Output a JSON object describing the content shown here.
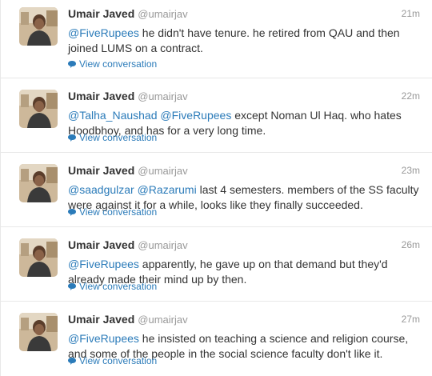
{
  "tweets": [
    {
      "name": "Umair Javed",
      "handle": "@umairjav",
      "time": "21m",
      "mentions": [
        "@FiveRupees"
      ],
      "body": " he didn't have tenure. he retired from QAU and then joined LUMS on a contract.",
      "conversation_label": "View conversation"
    },
    {
      "name": "Umair Javed",
      "handle": "@umairjav",
      "time": "22m",
      "mentions": [
        "@Talha_Naushad",
        "@FiveRupees"
      ],
      "body": " except Noman Ul Haq. who hates Hoodbhoy, and has for a very long time.",
      "conversation_label": "View conversation"
    },
    {
      "name": "Umair Javed",
      "handle": "@umairjav",
      "time": "23m",
      "mentions": [
        "@saadgulzar",
        "@Razarumi"
      ],
      "body": " last 4 semesters. members of the SS faculty were against it for a while, looks like they finally succeeded.",
      "conversation_label": "View conversation"
    },
    {
      "name": "Umair Javed",
      "handle": "@umairjav",
      "time": "26m",
      "mentions": [
        "@FiveRupees"
      ],
      "body": " apparently, he gave up on that demand but they'd already made their mind up by then.",
      "conversation_label": "View conversation"
    },
    {
      "name": "Umair Javed",
      "handle": "@umairjav",
      "time": "27m",
      "mentions": [
        "@FiveRupees"
      ],
      "body": " he insisted on teaching a science and religion course, and some of the people in the social science faculty don't like it.",
      "conversation_label": "View conversation"
    }
  ],
  "icons": {
    "conversation": "speech-bubble-icon",
    "avatar": "user-photo"
  },
  "colors": {
    "link": "#2b7bb9",
    "muted": "#999999",
    "text": "#333333",
    "divider": "#e8e8e8"
  }
}
